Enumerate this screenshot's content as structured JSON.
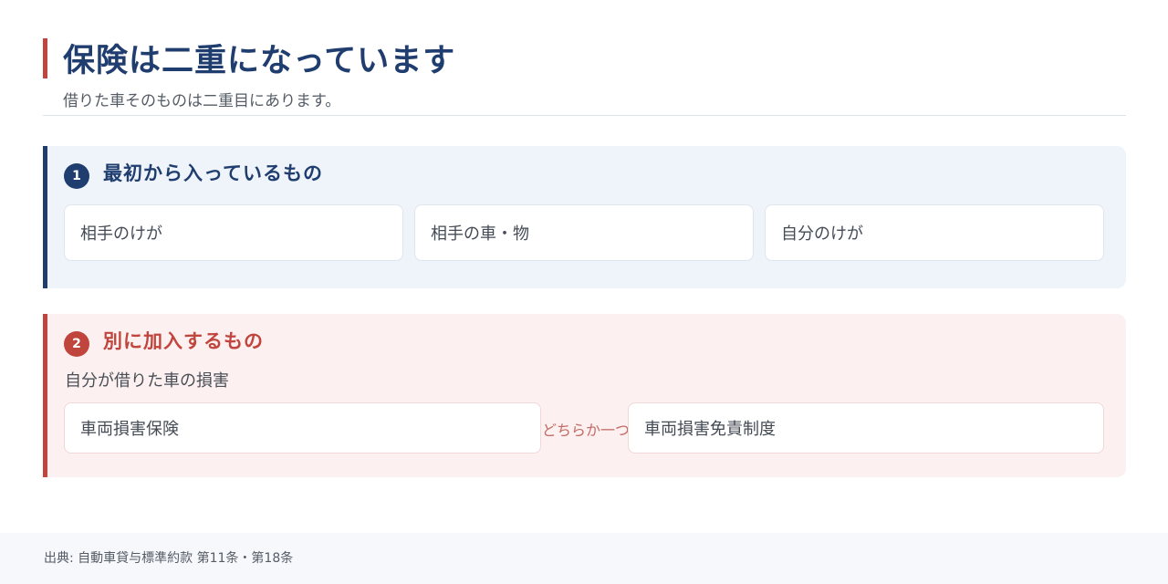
{
  "header": {
    "title": "保険は二重になっています",
    "subtitle": "借りた車そのものは二重目にあります。"
  },
  "section1": {
    "number": "1",
    "title": "最初から入っているもの",
    "cards": [
      "相手のけが",
      "相手の車・物",
      "自分のけが"
    ]
  },
  "section2": {
    "number": "2",
    "title": "別に加入するもの",
    "description": "自分が借りた車の損害",
    "cards": [
      "車両損害保険",
      "車両損害免責制度"
    ],
    "connector": "どちらか一つ"
  },
  "footer": {
    "source": "出典: 自動車貸与標準約款 第11条・第18条"
  },
  "colors": {
    "navy": "#1f3d6e",
    "red": "#c0453c"
  }
}
